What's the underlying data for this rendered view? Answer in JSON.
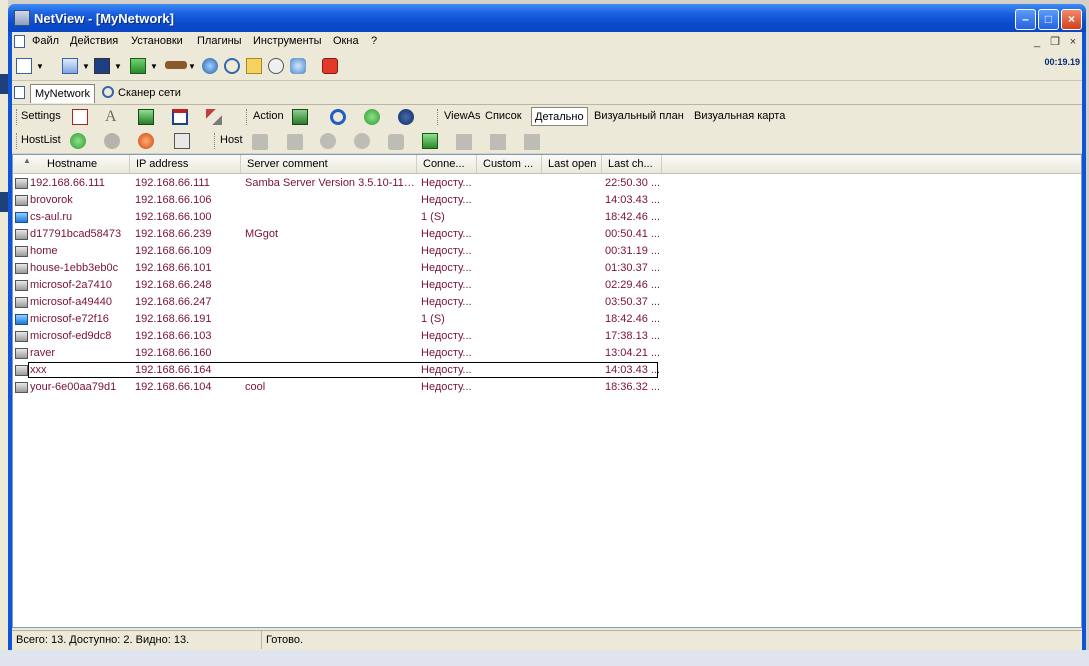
{
  "window": {
    "title": "NetView - [MyNetwork]"
  },
  "menu": [
    "Файл",
    "Действия",
    "Установки",
    "Плагины",
    "Инструменты",
    "Окна",
    "?"
  ],
  "toolbar": {
    "clock": "00:19.19"
  },
  "tabs": [
    "MyNetwork",
    "Сканер сети"
  ],
  "row1": {
    "settings": "Settings",
    "action": "Action",
    "viewas": "ViewAs",
    "views": [
      "Список",
      "Детально",
      "Визуальный план",
      "Визуальная карта"
    ]
  },
  "row2": {
    "hostlist": "HostList",
    "host": "Host"
  },
  "columns": [
    "Hostname",
    "IP address",
    "Server comment",
    "Conne...",
    "Custom ...",
    "Last open",
    "Last ch..."
  ],
  "rows": [
    {
      "host": "192.168.66.111",
      "ip": "192.168.66.111",
      "comment": "Samba Server Version 3.5.10-114....",
      "conn": "Недосту...",
      "last": "22:50.30 ...",
      "icon": "gray"
    },
    {
      "host": "brovorok",
      "ip": "192.168.66.106",
      "comment": "",
      "conn": "Недосту...",
      "last": "14:03.43 ...",
      "icon": "gray"
    },
    {
      "host": "cs-aul.ru",
      "ip": "192.168.66.100",
      "comment": "",
      "conn": "1 (S)",
      "last": "18:42.46 ...",
      "icon": "blue"
    },
    {
      "host": "d17791bcad58473",
      "ip": "192.168.66.239",
      "comment": "MGgot",
      "conn": "Недосту...",
      "last": "00:50.41 ...",
      "icon": "gray"
    },
    {
      "host": "home",
      "ip": "192.168.66.109",
      "comment": "",
      "conn": "Недосту...",
      "last": "00:31.19 ...",
      "icon": "gray"
    },
    {
      "host": "house-1ebb3eb0c",
      "ip": "192.168.66.101",
      "comment": "",
      "conn": "Недосту...",
      "last": "01:30.37 ...",
      "icon": "gray"
    },
    {
      "host": "microsof-2a7410",
      "ip": "192.168.66.248",
      "comment": "",
      "conn": "Недосту...",
      "last": "02:29.46 ...",
      "icon": "gray"
    },
    {
      "host": "microsof-a49440",
      "ip": "192.168.66.247",
      "comment": "",
      "conn": "Недосту...",
      "last": "03:50.37 ...",
      "icon": "gray"
    },
    {
      "host": "microsof-e72f16",
      "ip": "192.168.66.191",
      "comment": "",
      "conn": "1 (S)",
      "last": "18:42.46 ...",
      "icon": "blue"
    },
    {
      "host": "microsof-ed9dc8",
      "ip": "192.168.66.103",
      "comment": "",
      "conn": "Недосту...",
      "last": "17:38.13 ...",
      "icon": "gray"
    },
    {
      "host": "raver",
      "ip": "192.168.66.160",
      "comment": "",
      "conn": "Недосту...",
      "last": "13:04.21 ...",
      "icon": "gray"
    },
    {
      "host": "xxx",
      "ip": "192.168.66.164",
      "comment": "",
      "conn": "Недосту...",
      "last": "14:03.43 ...",
      "icon": "gray",
      "selected": true
    },
    {
      "host": "your-6e00aa79d1",
      "ip": "192.168.66.104",
      "comment": "cool",
      "conn": "Недосту...",
      "last": "18:36.32 ...",
      "icon": "gray"
    }
  ],
  "status": {
    "counts": "Всего: 13. Доступно: 2. Видно: 13.",
    "state": "Готово."
  }
}
